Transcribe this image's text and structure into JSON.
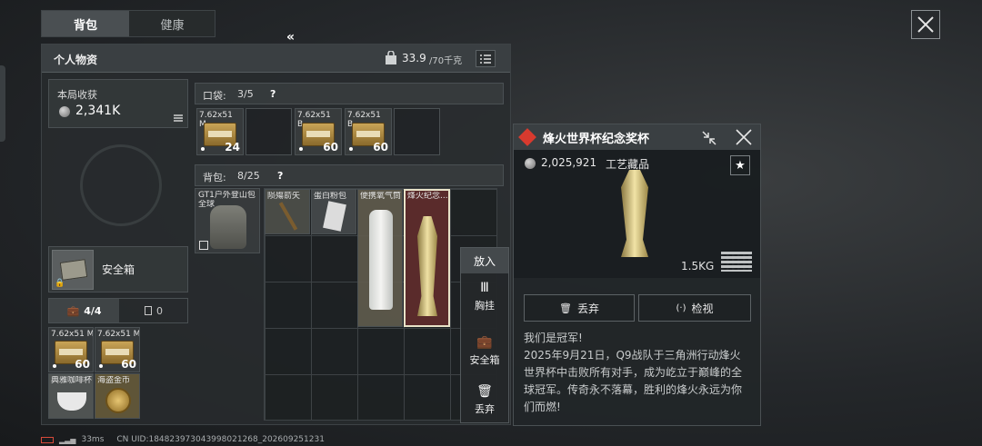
{
  "tabs": {
    "backpack": "背包",
    "health": "健康"
  },
  "personal": {
    "title": "个人物资",
    "weight_current": "33.9",
    "weight_max": "/70千克"
  },
  "earnings": {
    "label": "本局收获",
    "value": "2,341K"
  },
  "pocket": {
    "label": "口袋:",
    "count": "3/5",
    "help": "?"
  },
  "pocket_items": [
    {
      "name": "7.62x51 M...",
      "count": "24"
    },
    {
      "name": "",
      "count": ""
    },
    {
      "name": "7.62x51 B...",
      "count": "60"
    },
    {
      "name": "7.62x51 B...",
      "count": "60"
    },
    {
      "name": "",
      "count": ""
    }
  ],
  "bag": {
    "label": "背包:",
    "count": "8/25",
    "help": "?"
  },
  "backpack_item": {
    "name": "GT1户外登山包",
    "sub": "全球"
  },
  "bag_items": [
    {
      "name": "陨殤箭矢"
    },
    {
      "name": "蛋白粉包"
    },
    {
      "name": "便携氧气筒"
    },
    {
      "name": "烽火纪念..."
    }
  ],
  "safe": {
    "label": "安全箱"
  },
  "bottom_tabs": {
    "case_count": "4/4",
    "other_count": "0"
  },
  "safe_items": [
    {
      "name": "7.62x51 M...",
      "count": "60"
    },
    {
      "name": "7.62x51 M...",
      "count": "60"
    },
    {
      "name": "典雅咖啡杯",
      "count": ""
    },
    {
      "name": "海盗金币",
      "count": ""
    }
  ],
  "context_menu": {
    "header": "放入",
    "items": [
      {
        "label": "胸挂"
      },
      {
        "label": "安全箱"
      },
      {
        "label": "丢弃"
      }
    ]
  },
  "detail": {
    "title": "烽火世界杯纪念奖杯",
    "price": "2,025,921",
    "category": "工艺藏品",
    "weight": "1.5KG",
    "discard_label": "丢弃",
    "inspect_label": "检视",
    "desc_title": "我们是冠军!",
    "desc_body": "2025年9月21日，Q9战队于三角洲行动烽火世界杯中击败所有对手，成为屹立于巅峰的全球冠军。传奇永不落幕，胜利的烽火永远为你们而燃!"
  },
  "status": {
    "ping": "33ms",
    "uid": "CN UID:1848239730439980212​68_202609251231"
  },
  "colors": {
    "accent_red": "#d83a2e",
    "selected_bg": "#5a2b2b",
    "highlight_border": "#e8e2c8"
  }
}
